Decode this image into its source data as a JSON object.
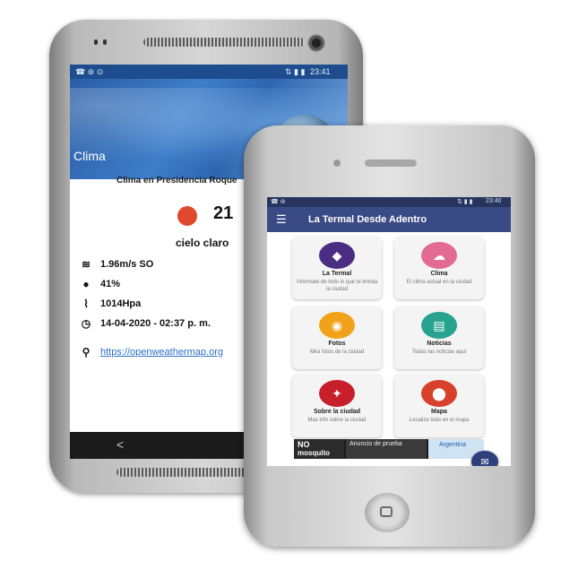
{
  "phone1": {
    "status_time": "23:41",
    "header_title": "Clima",
    "location_label": "Clima en Presidencia Roque",
    "temperature": "21",
    "condition": "cielo claro",
    "wind": "1.96m/s  SO",
    "humidity": "41%",
    "pressure": "1014Hpa",
    "datetime": "14-04-2020 - 02:37 p. m.",
    "link": "https://openweathermap.org",
    "back_glyph": "<"
  },
  "phone2": {
    "status_time": "23:40",
    "app_title": "La Termal Desde Adentro",
    "cards": [
      {
        "title": "La Termal",
        "desc": "Informate de todo lo que te brinda la ciudad",
        "color": "#4b2e83",
        "icon": "tag-icon"
      },
      {
        "title": "Clima",
        "desc": "El clima actual en la ciudad",
        "color": "#e36a92",
        "icon": "cloud-icon"
      },
      {
        "title": "Fotos",
        "desc": "Mira fotos de la ciudad",
        "color": "#f2a21a",
        "icon": "camera-icon"
      },
      {
        "title": "Noticias",
        "desc": "Todas las noticias aqui",
        "color": "#27a38f",
        "icon": "news-icon"
      },
      {
        "title": "Sobre la ciudad",
        "desc": "Mas info sobre la ciudad",
        "color": "#c8202a",
        "icon": "compass-icon"
      },
      {
        "title": "Mapa",
        "desc": "Localiza todo en el mapa",
        "color": "#d9402b",
        "icon": "map-pin-icon"
      }
    ],
    "ad_left": "NO",
    "ad_left2": "mosquito",
    "ad_center": "Anuncio de prueba",
    "ad_right": "Argentina"
  }
}
